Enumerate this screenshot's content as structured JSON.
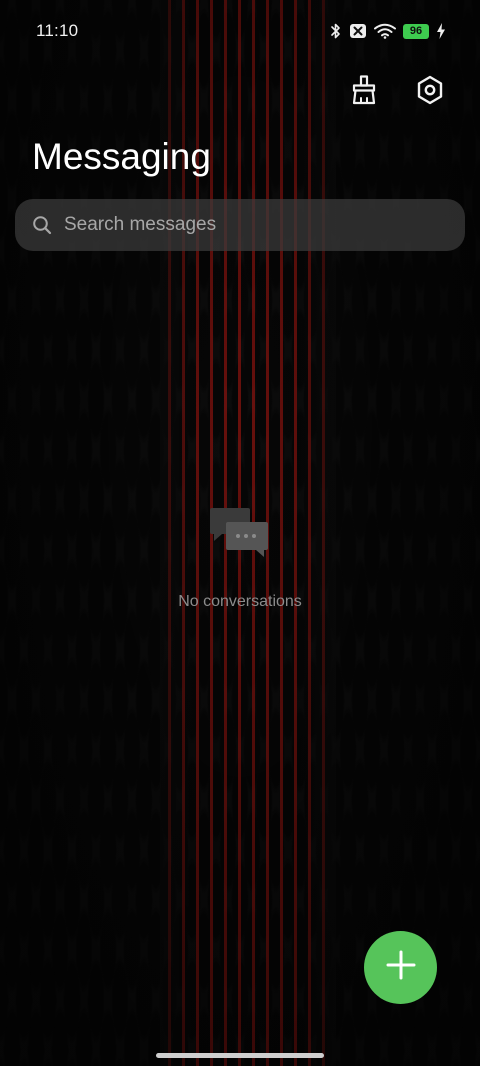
{
  "status_bar": {
    "time": "11:10",
    "battery_level": "96",
    "icons": [
      "bluetooth-icon",
      "no-sim-icon",
      "wifi-icon",
      "battery-icon",
      "charging-icon"
    ],
    "battery_color": "#3ecb4f"
  },
  "header": {
    "title": "Messaging",
    "actions": [
      "clean-brush-icon",
      "settings-gear-icon"
    ]
  },
  "search": {
    "placeholder": "Search messages"
  },
  "empty_state": {
    "icon": "chat-bubbles-icon",
    "text": "No conversations"
  },
  "fab": {
    "icon": "plus-icon",
    "color": "#56c45a"
  }
}
